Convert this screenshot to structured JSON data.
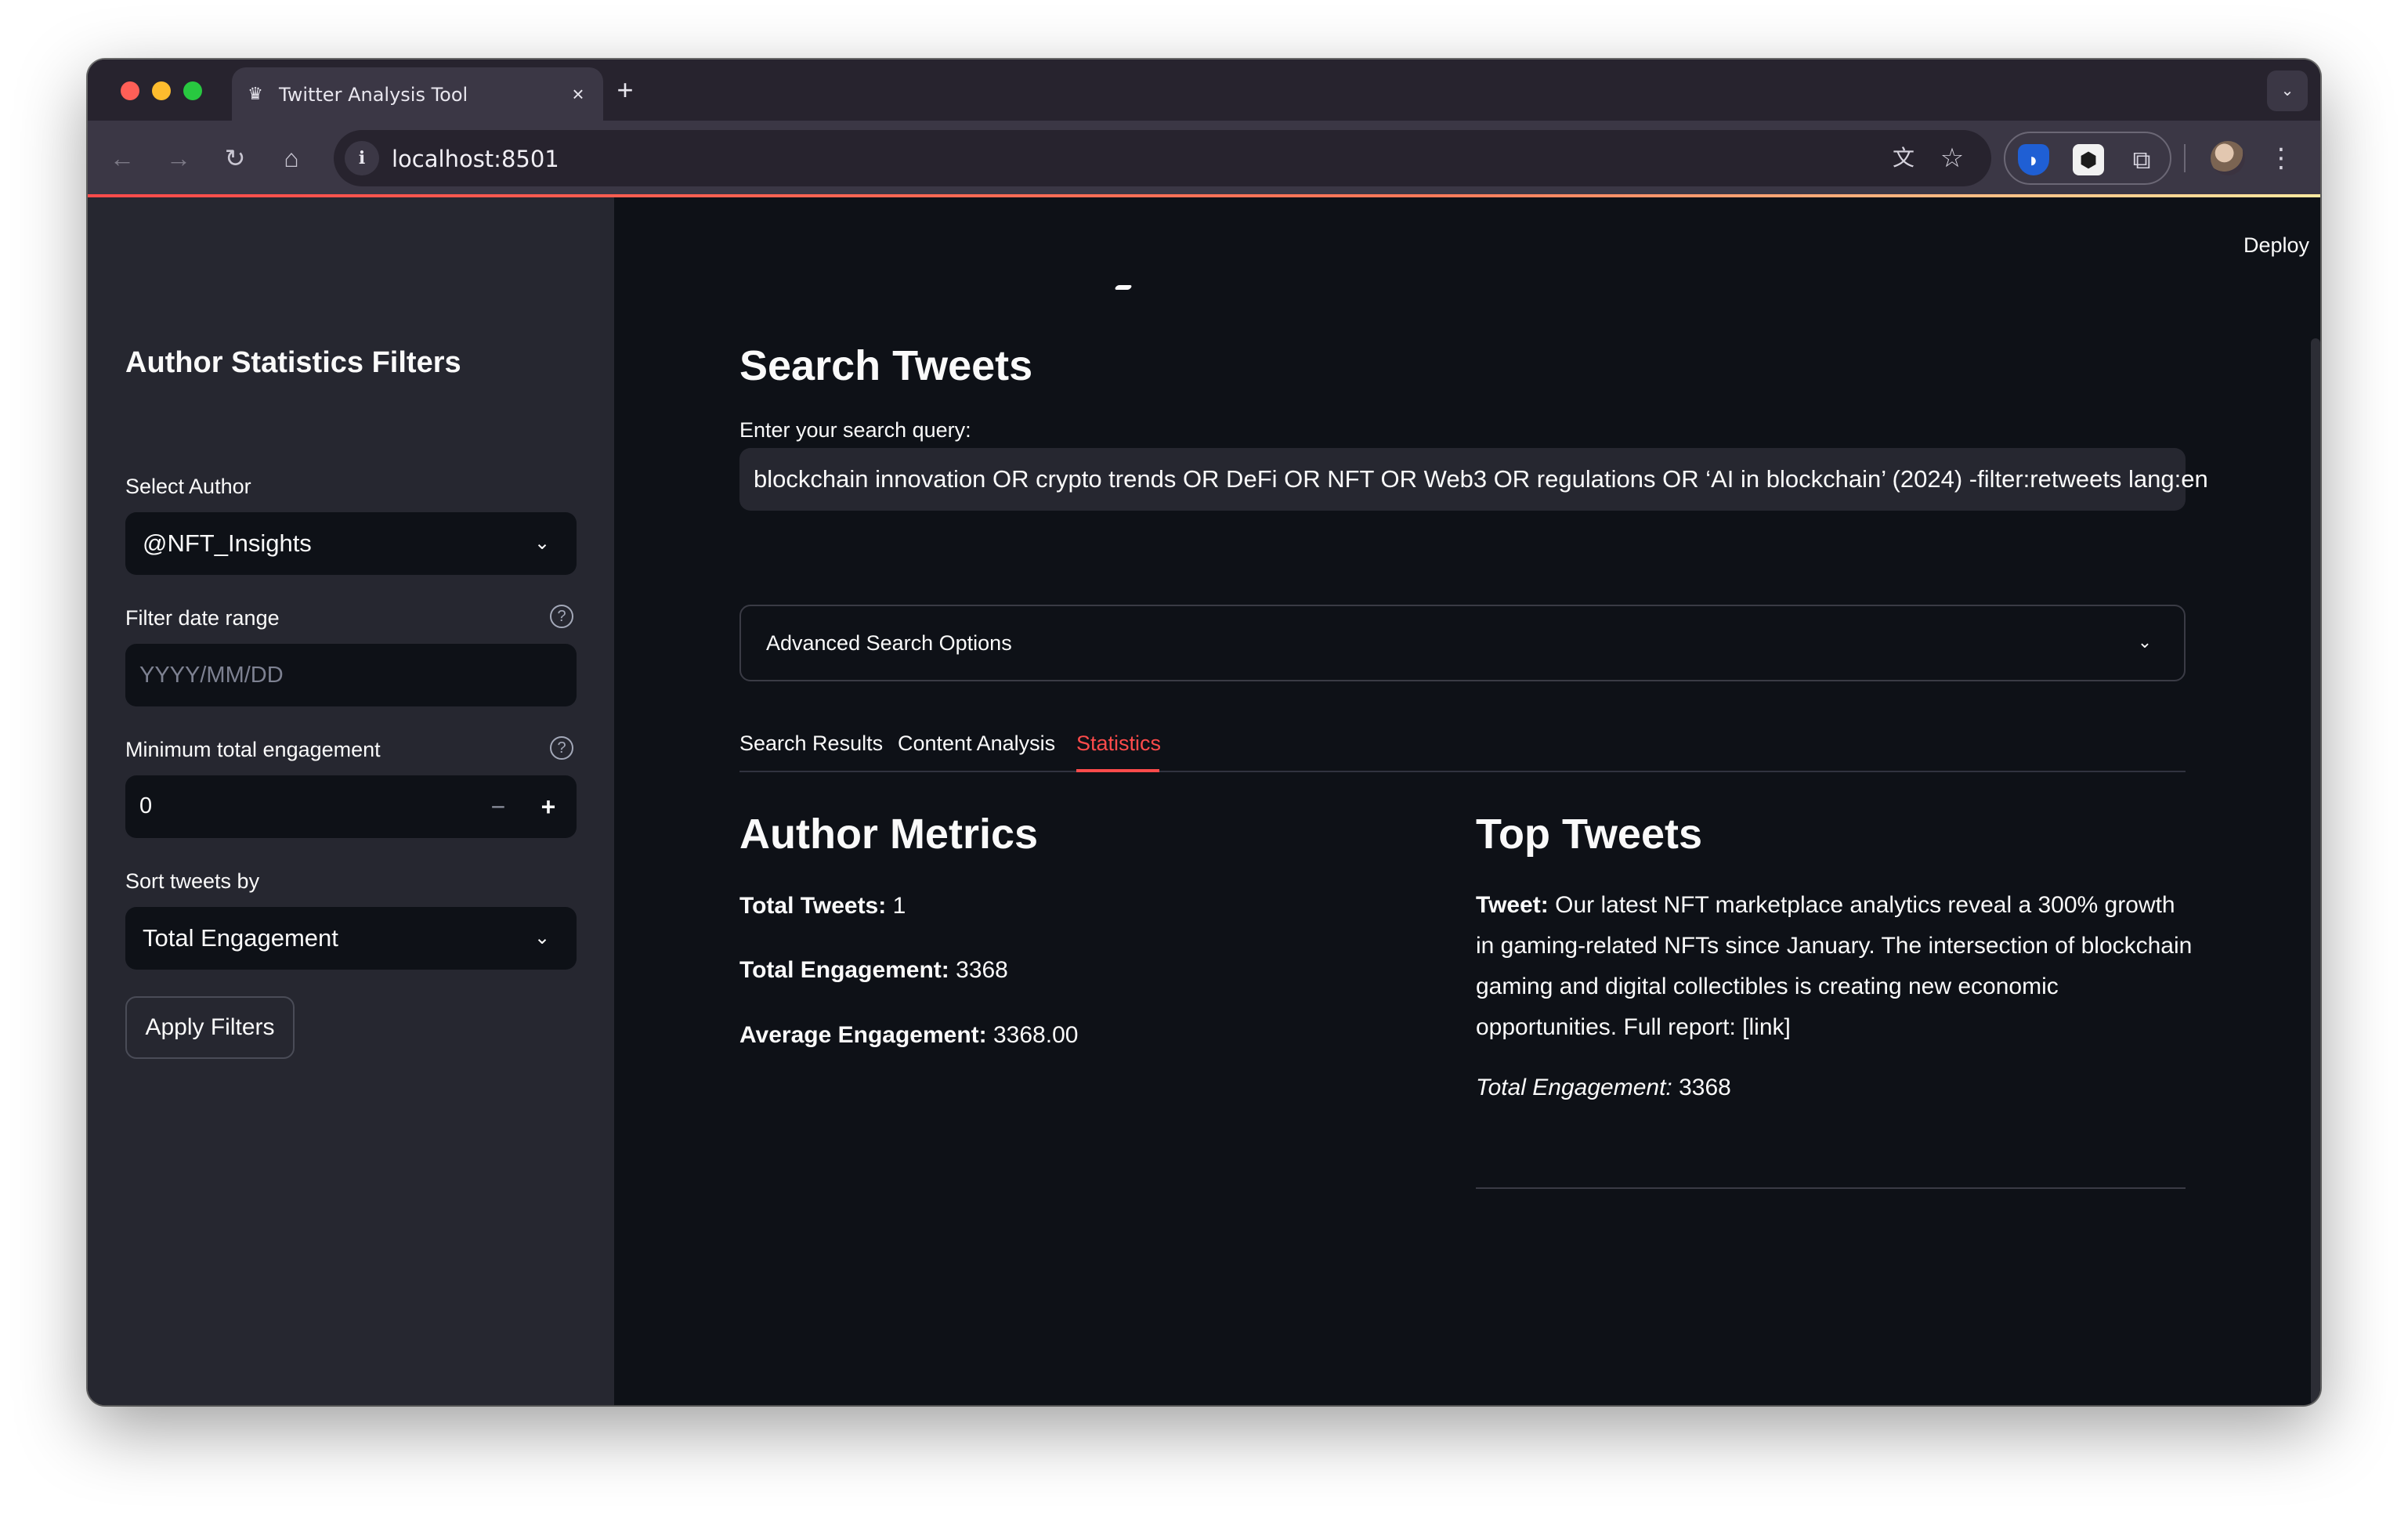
{
  "browser": {
    "tab_title": "Twitter Analysis Tool",
    "tab_favicon": "crown-icon",
    "url": "localhost:8501",
    "new_tab_icon": "plus-icon",
    "extensions": [
      "bitwarden-icon",
      "extension-icon",
      "puzzle-icon"
    ]
  },
  "sidebar": {
    "heading": "Author Statistics Filters",
    "author_label": "Select Author",
    "author_value": "@NFT_Insights",
    "date_label": "Filter date range",
    "date_placeholder": "YYYY/MM/DD",
    "engagement_label": "Minimum total engagement",
    "engagement_value": "0",
    "minus": "−",
    "plus": "+",
    "sort_label": "Sort tweets by",
    "sort_value": "Total Engagement",
    "apply_button": "Apply Filters"
  },
  "header": {
    "deploy": "Deploy"
  },
  "main": {
    "title": "Search Tweets",
    "query_label": "Enter your search query:",
    "query_value": "blockchain innovation OR crypto trends OR DeFi OR NFT OR Web3 OR regulations OR ‘AI in blockchain’ (2024) -filter:retweets lang:en",
    "advanced_label": "Advanced Search Options",
    "tabs": [
      {
        "label": "Search Results",
        "active": false
      },
      {
        "label": "Content Analysis",
        "active": false
      },
      {
        "label": "Statistics",
        "active": true
      }
    ],
    "author_metrics": {
      "heading": "Author Metrics",
      "total_tweets_label": "Total Tweets:",
      "total_tweets_value": " 1",
      "total_engagement_label": "Total Engagement:",
      "total_engagement_value": " 3368",
      "avg_engagement_label": "Average Engagement:",
      "avg_engagement_value": " 3368.00"
    },
    "top_tweets": {
      "heading": "Top Tweets",
      "tweet_label": "Tweet:",
      "tweet_text": " Our latest NFT marketplace analytics reveal a 300% growth in gaming-related NFTs since January. The intersection of blockchain gaming and digital collectibles is creating new economic opportunities. Full report: [link]",
      "engagement_label": "Total Engagement:",
      "engagement_value": " 3368"
    }
  },
  "colors": {
    "accent": "#ff4b4b",
    "sidebar_bg": "#262730",
    "main_bg": "#0e1117",
    "text": "#fafafa"
  }
}
